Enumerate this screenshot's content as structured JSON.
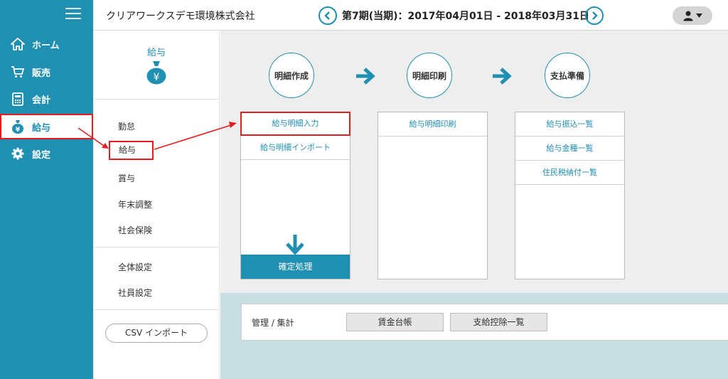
{
  "nav": {
    "items": [
      {
        "label": "ホーム",
        "icon": "home-icon"
      },
      {
        "label": "販売",
        "icon": "cart-icon"
      },
      {
        "label": "会計",
        "icon": "calculator-icon"
      },
      {
        "label": "給与",
        "icon": "money-bag-icon"
      },
      {
        "label": "設定",
        "icon": "gear-icon"
      }
    ],
    "active": "給与"
  },
  "header": {
    "company": "クリアワークスデモ環境株式会社",
    "period": "第7期(当期)：2017年04月01日 - 2018年03月31日"
  },
  "subnav": {
    "title": "給与",
    "items": [
      "勤怠",
      "給与",
      "賞与",
      "年末調整",
      "社会保険",
      "全体設定",
      "社員設定"
    ],
    "active": "給与",
    "csv_button": "CSV インポート"
  },
  "workflow": {
    "steps": [
      "明細作成",
      "明細印刷",
      "支払準備"
    ],
    "panels": [
      {
        "links": [
          "給与明細入力",
          "給与明細インポート"
        ],
        "action": "確定処理"
      },
      {
        "links": [
          "給与明細印刷"
        ]
      },
      {
        "links": [
          "給与振込一覧",
          "給与金種一覧",
          "住民税納付一覧"
        ]
      }
    ]
  },
  "management": {
    "label": "管理 / 集計",
    "buttons": [
      "賃金台帳",
      "支給控除一覧"
    ]
  },
  "colors": {
    "brand": "#1f8fb2",
    "highlight": "#e41e1e"
  }
}
